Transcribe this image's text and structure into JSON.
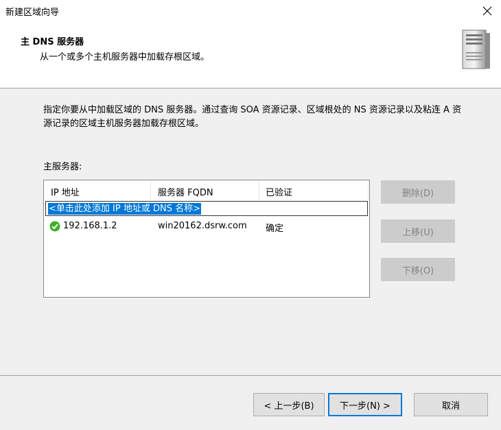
{
  "window": {
    "title": "新建区域向导"
  },
  "header": {
    "heading": "主 DNS 服务器",
    "subheading": "从一个或多个主机服务器中加载存根区域。"
  },
  "main": {
    "description": "指定你要从中加载区域的 DNS 服务器。通过查询 SOA 资源记录、区域根处的 NS 资源记录以及粘连 A 资源记录的区域主机服务器加载存根区域。",
    "list_label": "主服务器:",
    "columns": [
      "IP 地址",
      "服务器 FQDN",
      "已验证"
    ],
    "add_placeholder": "<单击此处添加 IP 地址或 DNS 名称>",
    "rows": [
      {
        "ip": "192.168.1.2",
        "fqdn": "win20162.dsrw.com",
        "verified": "确定"
      }
    ],
    "buttons": {
      "delete": "删除(D)",
      "up": "上移(U)",
      "down": "下移(O)"
    }
  },
  "footer": {
    "back": "< 上一步(B)",
    "next": "下一步(N) >",
    "cancel": "取消"
  },
  "colors": {
    "accent": "#0078d7",
    "ok_green": "#3fae29"
  }
}
